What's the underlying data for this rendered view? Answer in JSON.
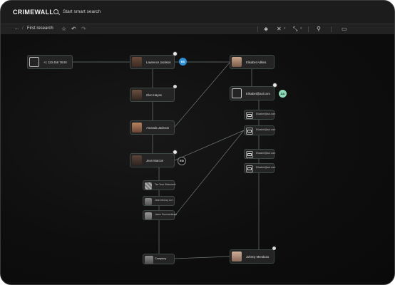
{
  "app": {
    "logo": "CRIMEWALL",
    "search_placeholder": "Start smart search"
  },
  "breadcrumb": {
    "root": "...",
    "separator": "/",
    "current": "First research"
  },
  "toolbar": {
    "icons": [
      "star-icon",
      "undo-icon",
      "redo-icon",
      "filter-icon",
      "layout-icon",
      "connect-icon",
      "pin-icon",
      "folder-icon"
    ]
  },
  "graph": {
    "nodes": {
      "phone": "+1 123 456 78 90",
      "lawrence": "Lawrence Jackson",
      "elisabet": "Elisabet Adkins",
      "glen": "Glen Hayes",
      "email_main": "Elisabet@aol.com",
      "amanda": "Amanda Jackson",
      "jean": "Jean Marcos",
      "email1": "Elisabet@aol.com",
      "email2": "Elisabet@aol.com",
      "email3": "Elisabet@aol.com",
      "email4": "Elisabet@aol.com",
      "doc1": "Tax Year Statement",
      "doc2": "Jean McCoy LLC",
      "doc3": "Jason Summerlands",
      "company": "Company",
      "johnny": "Johnny Mendoza"
    },
    "badges": {
      "lawrence": "BS",
      "email_main": "DA",
      "jean": "EG"
    },
    "badge_colors": {
      "lawrence": "#2d8fd6",
      "email_main": "#8fd9b6",
      "jean": "#111111"
    }
  }
}
